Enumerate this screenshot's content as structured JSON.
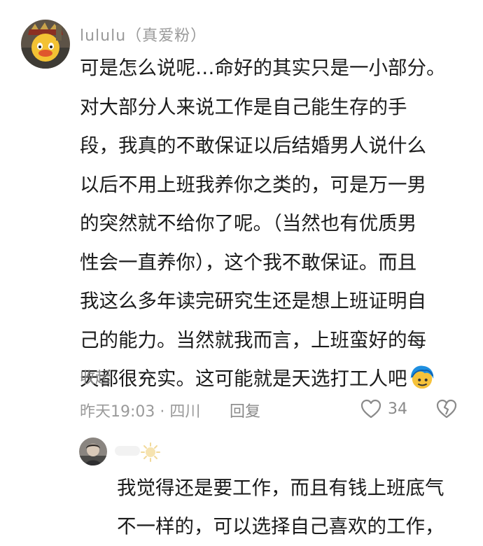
{
  "comment": {
    "username": "lululu（真爱粉）",
    "lines": [
      "可是怎么说呢…命好的其实只是一小部分。",
      "对大部分人来说工作是自己能生存的手",
      "段，我真的不敢保证以后结婚男人说什么",
      "以后不用上班我养你之类的，可是万一男",
      "的突然就不给你了呢。（当然也有优质男",
      "性会一直养你），这个我不敢保证。而且",
      "我这么多年读完研究生还是想上班证明自",
      "己的能力。当然就我而言，上班蛮好的每",
      "天都很充实。这可能就是天选打工人吧"
    ],
    "trailing_emoji": "blue-hair-face-emoji",
    "collapse_label": "收起",
    "time_location": "昨天19:03 · 四川",
    "reply_label": "回复",
    "like_count": "34",
    "icons": {
      "like": "heart-outline-icon",
      "dislike": "broken-heart-icon",
      "user_badge": "sun-icon"
    }
  },
  "reply": {
    "lines": [
      "我觉得还是要工作，而且有钱上班底气",
      "不一样的，可以选择自己喜欢的工作，"
    ]
  },
  "colors": {
    "body_text": "#1b1b1b",
    "meta_text": "#9a9a9a",
    "icon_stroke": "#8a8a8a"
  }
}
